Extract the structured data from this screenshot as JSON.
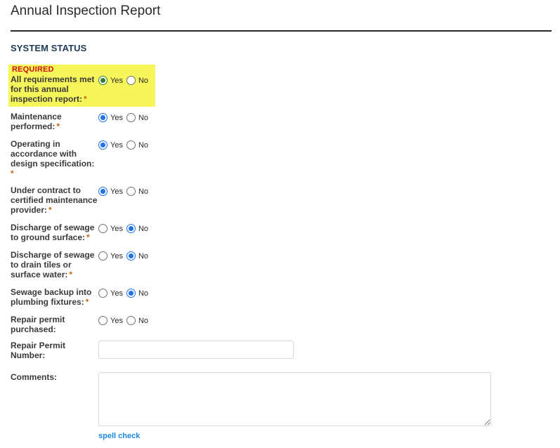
{
  "page": {
    "title": "Annual Inspection Report"
  },
  "section": {
    "heading": "SYSTEM STATUS",
    "required_tag": "REQUIRED"
  },
  "options": {
    "yes": "Yes",
    "no": "No"
  },
  "required_marker": "*",
  "fields": [
    {
      "label": "All requirements met for this annual inspection report:",
      "required": true,
      "selected": "Yes",
      "highlighted": true
    },
    {
      "label": "Maintenance performed:",
      "required": true,
      "selected": "Yes"
    },
    {
      "label": "Operating in accordance with design specification:",
      "required": true,
      "selected": "Yes"
    },
    {
      "label": "Under contract to certified maintenance provider:",
      "required": true,
      "selected": "Yes"
    },
    {
      "label": "Discharge of sewage to ground surface:",
      "required": true,
      "selected": "No"
    },
    {
      "label": "Discharge of sewage to drain tiles or surface water:",
      "required": true,
      "selected": "No"
    },
    {
      "label": "Sewage backup into plumbing fixtures:",
      "required": true,
      "selected": "No"
    },
    {
      "label": "Repair permit purchased:",
      "required": false,
      "selected": ""
    }
  ],
  "repair_permit": {
    "label": "Repair Permit Number:",
    "value": ""
  },
  "comments": {
    "label": "Comments:",
    "value": ""
  },
  "spell_check": "spell check",
  "colors": {
    "highlight": "#f6f55a",
    "required_red": "#cc1111",
    "star_orange": "#c06a10",
    "radio_blue": "#1a73e8",
    "radio_green": "#2e7d32",
    "link_blue": "#1e88e5",
    "heading_navy": "#1f3b57"
  }
}
